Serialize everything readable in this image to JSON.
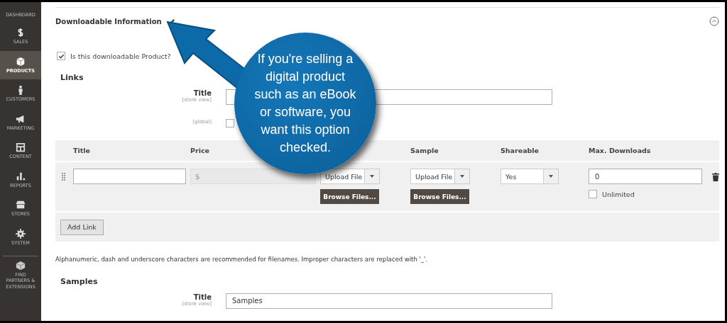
{
  "sidebar": {
    "items": [
      {
        "label": "DASHBOARD",
        "selected": false
      },
      {
        "label": "SALES",
        "selected": false
      },
      {
        "label": "PRODUCTS",
        "selected": true
      },
      {
        "label": "CUSTOMERS",
        "selected": false
      },
      {
        "label": "MARKETING",
        "selected": false
      },
      {
        "label": "CONTENT",
        "selected": false
      },
      {
        "label": "REPORTS",
        "selected": false
      },
      {
        "label": "STORES",
        "selected": false
      },
      {
        "label": "SYSTEM",
        "selected": false
      },
      {
        "label": "FIND PARTNERS & EXTENSIONS",
        "selected": false
      }
    ]
  },
  "section": {
    "title": "Downloadable Information",
    "expanded": true
  },
  "downloadable": {
    "label": "Is this downloadable Product?",
    "checked": true
  },
  "links": {
    "heading": "Links",
    "title_field": {
      "label": "Title",
      "scope": "[store view]"
    },
    "global_scope": "[global]",
    "global_checked": false,
    "table": {
      "columns": [
        "Title",
        "Price",
        "Sample",
        "Shareable",
        "Max. Downloads"
      ],
      "rows": [
        {
          "price_prefix": "$",
          "file_type": "Upload File",
          "browse": "Browse Files...",
          "sample_type": "Upload File",
          "sample_browse": "Browse Files...",
          "shareable": "Yes",
          "max_downloads": "0",
          "unlimited_label": "Unlimited",
          "unlimited": false
        }
      ]
    },
    "add_button": "Add Link"
  },
  "note": "Alphanumeric, dash and underscore characters are recommended for filenames. Improper characters are replaced with '_'.",
  "samples": {
    "heading": "Samples",
    "title_field": {
      "label": "Title",
      "scope": "[store view]",
      "value": "Samples"
    }
  },
  "callout": {
    "text": "If you're selling a digital product such as an eBook or software, you want this option checked."
  }
}
